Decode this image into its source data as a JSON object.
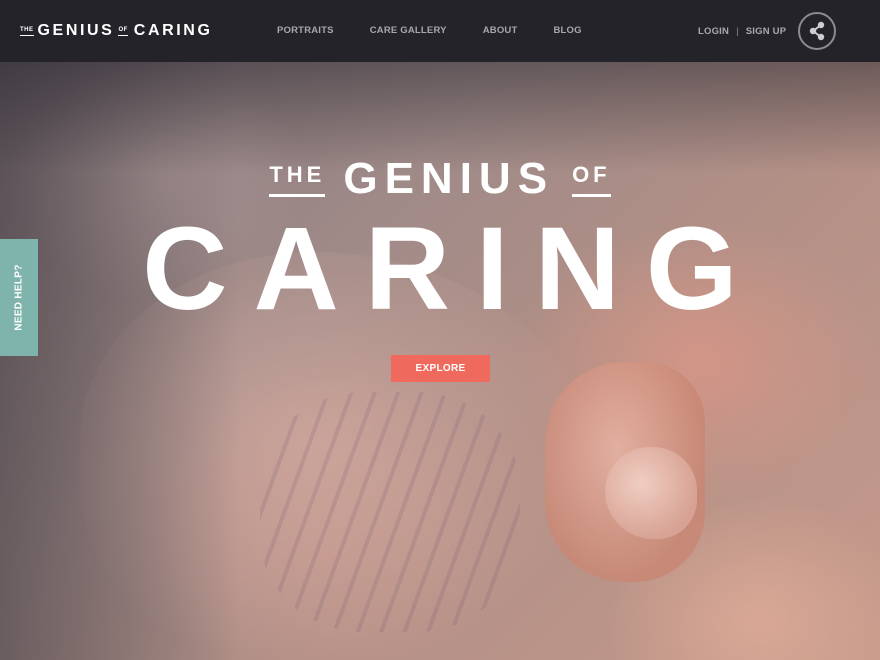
{
  "logo": {
    "the": "THE",
    "genius": "GENIUS",
    "of": "OF",
    "caring": "CARING"
  },
  "nav": {
    "items": [
      {
        "label": "PORTRAITS"
      },
      {
        "label": "CARE GALLERY"
      },
      {
        "label": "ABOUT"
      },
      {
        "label": "BLOG"
      }
    ],
    "login": "LOGIN",
    "separator": "|",
    "signup": "SIGN UP",
    "share_icon": "share-icon"
  },
  "hero": {
    "the": "THE",
    "genius": "GENIUS",
    "of": "OF",
    "caring": "CARING",
    "explore_label": "EXPLORE"
  },
  "side_tab": {
    "label": "NEED HELP?"
  },
  "colors": {
    "nav_bg": "#25232a",
    "nav_text": "#a9a7ad",
    "explore_button": "#ef6a5c",
    "need_help_tab": "#7fb4ad"
  }
}
